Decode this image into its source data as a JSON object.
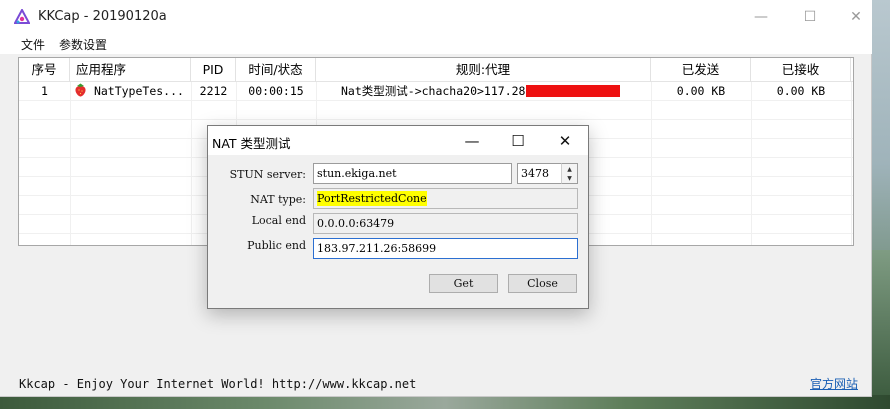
{
  "window": {
    "title": "KKCap - 20190120a",
    "controls": {
      "minimize": "—",
      "maximize": "☐",
      "close": "✕"
    }
  },
  "menu": [
    "文件",
    "参数设置"
  ],
  "list": {
    "columns": [
      "序号",
      "应用程序",
      "PID",
      "时间/状态",
      "规则:代理",
      "已发送",
      "已接收"
    ],
    "rows": [
      {
        "index": "1",
        "app": "NatTypeTes...",
        "pid": "2212",
        "time": "00:00:15",
        "rule": "Nat类型测试->chacha20>117.28",
        "rule_redacted": true,
        "sent": "0.00 KB",
        "received": "0.00 KB"
      }
    ]
  },
  "status": {
    "text": "Kkcap - Enjoy Your Internet World! http://www.kkcap.net",
    "link": "官方网站"
  },
  "dialog": {
    "title": "NAT 类型测试",
    "controls": {
      "minimize": "—",
      "maximize": "☐",
      "close": "✕"
    },
    "stun_label": "STUN server:",
    "stun_value": "stun.ekiga.net",
    "port_value": "3478",
    "nat_type_label": "NAT type:",
    "nat_type_value": "PortRestrictedCone",
    "local_end_label": "Local end",
    "local_end_value": "0.0.0.0:63479",
    "public_end_label": "Public end",
    "public_end_value": "183.97.211.26:58699",
    "get_button": "Get",
    "close_button": "Close"
  },
  "colors": {
    "highlight": "#ffff00",
    "redaction": "#ee1111",
    "link": "#1a5fb4",
    "focus_border": "#2c6fd1"
  }
}
